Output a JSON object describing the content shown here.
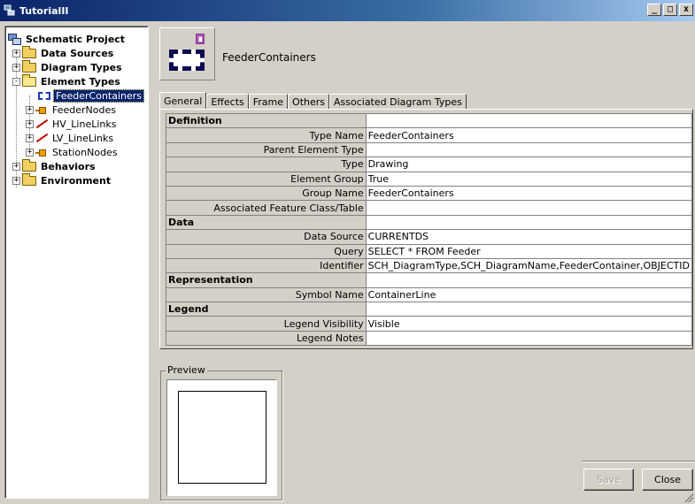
{
  "window": {
    "title": "TutorialII",
    "controls": [
      "_",
      "□",
      "x"
    ]
  },
  "tree": {
    "items": [
      {
        "label": "Schematic Project",
        "icon": "project-icon",
        "bold": true
      },
      {
        "label": "Data Sources",
        "icon": "folder-icon",
        "bold": true,
        "expander": "+"
      },
      {
        "label": "Diagram Types",
        "icon": "folder-icon",
        "bold": true,
        "expander": "+"
      },
      {
        "label": "Element Types",
        "icon": "folder-open-icon",
        "bold": true,
        "expander": "-"
      },
      {
        "label": "FeederContainers",
        "icon": "container-icon",
        "selected": true
      },
      {
        "label": "FeederNodes",
        "icon": "node-icon",
        "expander": "+"
      },
      {
        "label": "HV_LineLinks",
        "icon": "link-icon",
        "expander": "+"
      },
      {
        "label": "LV_LineLinks",
        "icon": "link-icon",
        "expander": "+"
      },
      {
        "label": "StationNodes",
        "icon": "node-icon",
        "expander": "+"
      },
      {
        "label": "Behaviors",
        "icon": "folder-icon",
        "bold": true,
        "expander": "+"
      },
      {
        "label": "Environment",
        "icon": "folder-icon",
        "bold": true,
        "expander": "+"
      }
    ]
  },
  "header": {
    "title": "FeederContainers"
  },
  "tabs": [
    {
      "label": "General",
      "active": true
    },
    {
      "label": "Effects"
    },
    {
      "label": "Frame"
    },
    {
      "label": "Others"
    },
    {
      "label": "Associated Diagram Types"
    }
  ],
  "properties": [
    {
      "key": "Definition",
      "value": "",
      "section": true
    },
    {
      "key": "Type Name",
      "value": "FeederContainers"
    },
    {
      "key": "Parent Element Type",
      "value": ""
    },
    {
      "key": "Type",
      "value": "Drawing"
    },
    {
      "key": "Element Group",
      "value": "True"
    },
    {
      "key": "Group Name",
      "value": "FeederContainers"
    },
    {
      "key": "Associated Feature Class/Table",
      "value": ""
    },
    {
      "key": "Data",
      "value": "",
      "section": true
    },
    {
      "key": "Data Source",
      "value": "CURRENTDS"
    },
    {
      "key": "Query",
      "value": "SELECT * FROM Feeder"
    },
    {
      "key": "Identifier",
      "value": "SCH_DiagramType,SCH_DiagramName,FeederContainer,OBJECTID"
    },
    {
      "key": "Representation",
      "value": "",
      "section": true
    },
    {
      "key": "Symbol Name",
      "value": "ContainerLine"
    },
    {
      "key": "Legend",
      "value": "",
      "section": true
    },
    {
      "key": "Legend Visibility",
      "value": "Visible"
    },
    {
      "key": "Legend Notes",
      "value": ""
    }
  ],
  "preview": {
    "label": "Preview"
  },
  "buttons": {
    "save": "Save",
    "close": "Close"
  }
}
